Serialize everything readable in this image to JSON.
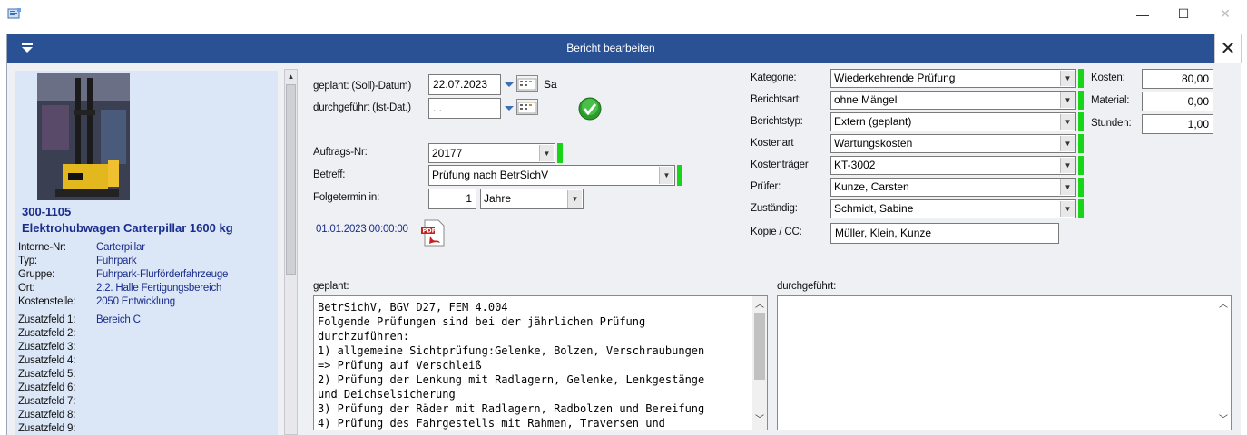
{
  "window": {
    "minimize": "—",
    "maximize": "☐",
    "close": "✕"
  },
  "dialog": {
    "title": "Bericht bearbeiten",
    "close": "✕"
  },
  "asset": {
    "number": "300-1105",
    "name": "Elektrohubwagen Carterpillar 1600 kg",
    "details": [
      {
        "label": "Interne-Nr:",
        "value": "Carterpillar"
      },
      {
        "label": "Typ:",
        "value": "Fuhrpark"
      },
      {
        "label": "Gruppe:",
        "value": "Fuhrpark-Flurförderfahrzeuge"
      },
      {
        "label": "Ort:",
        "value": "2.2. Halle Fertigungsbereich"
      },
      {
        "label": "Kostenstelle:",
        "value": "2050 Entwicklung"
      }
    ],
    "extra_fields": [
      {
        "label": "Zusatzfeld 1:",
        "value": "Bereich C"
      },
      {
        "label": "Zusatzfeld 2:",
        "value": ""
      },
      {
        "label": "Zusatzfeld 3:",
        "value": ""
      },
      {
        "label": "Zusatzfeld 4:",
        "value": ""
      },
      {
        "label": "Zusatzfeld 5:",
        "value": ""
      },
      {
        "label": "Zusatzfeld 6:",
        "value": ""
      },
      {
        "label": "Zusatzfeld 7:",
        "value": ""
      },
      {
        "label": "Zusatzfeld 8:",
        "value": ""
      },
      {
        "label": "Zusatzfeld 9:",
        "value": ""
      }
    ]
  },
  "form": {
    "planned_date_label": "geplant: (Soll)-Datum)",
    "planned_date": "22.07.2023",
    "planned_weekday": "Sa",
    "done_date_label": "durchgeführt (Ist-Dat.)",
    "done_date": " . .",
    "order_label": "Auftrags-Nr:",
    "order_value": "20177",
    "subject_label": "Betreff:",
    "subject_value": "Prüfung nach BetrSichV",
    "next_label": "Folgetermin in:",
    "next_value": "1",
    "next_unit": "Jahre",
    "timestamp": "01.01.2023 00:00:00",
    "pdf_icon": "pdf-icon"
  },
  "classification": {
    "rows": [
      {
        "label": "Kategorie:",
        "value": "Wiederkehrende Prüfung"
      },
      {
        "label": "Berichtsart:",
        "value": "ohne Mängel"
      },
      {
        "label": "Berichtstyp:",
        "value": "Extern (geplant)"
      },
      {
        "label": "Kostenart",
        "value": "Wartungskosten"
      },
      {
        "label": "Kostenträger",
        "value": "KT-3002"
      },
      {
        "label": "Prüfer:",
        "value": "Kunze, Carsten"
      },
      {
        "label": "Zuständig:",
        "value": "Schmidt, Sabine"
      }
    ],
    "cc_label": "Kopie / CC:",
    "cc_value": "Müller, Klein, Kunze"
  },
  "costs": [
    {
      "label": "Kosten:",
      "value": "80,00"
    },
    {
      "label": "Material:",
      "value": "0,00"
    },
    {
      "label": "Stunden:",
      "value": "1,00"
    }
  ],
  "notes": {
    "planned_label": "geplant:",
    "planned_lines": [
      "BetrSichV, BGV D27, FEM 4.004",
      "Folgende Prüfungen sind bei der jährlichen Prüfung",
      "durchzuführen:",
      "1) allgemeine Sichtprüfung:Gelenke, Bolzen, Verschraubungen",
      "=> Prüfung auf Verschleiß",
      "2) Prüfung der Lenkung mit Radlagern, Gelenke, Lenkgestänge",
      "und Deichselsicherung",
      "3) Prüfung der Räder mit Radlagern, Radbolzen und Bereifung",
      "4) Prüfung des Fahrgestells mit Rahmen, Traversen und"
    ],
    "done_label": "durchgeführt:"
  },
  "colors": {
    "header_blue": "#2a5193",
    "panel_blue": "#dbe6f6",
    "status_green": "#19d419",
    "value_text": "#1a2d8c"
  }
}
